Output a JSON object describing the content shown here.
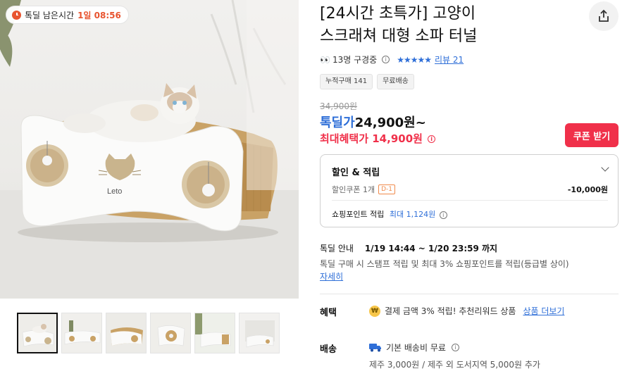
{
  "timer": {
    "label": "톡딜 남은시간",
    "value": "1일 08:56"
  },
  "product": {
    "title_line1": "[24시간 초특가] 고양이",
    "title_line2": "스크래쳐 대형 소파 터널",
    "viewers": "13명 구경중",
    "stars": "★★★★★",
    "rating": 5,
    "review_link": "리뷰 21",
    "chips": [
      "누적구매 141",
      "무료배송"
    ],
    "original_price": "34,900원",
    "deal_label": "톡딜가",
    "deal_price": "24,900원~",
    "max_benefit_label": "최대혜택가",
    "max_benefit_price": "14,900원",
    "coupon_button": "쿠폰 받기"
  },
  "discount": {
    "title": "할인 & 적립",
    "coupon_label": "할인쿠폰 1개",
    "coupon_badge": "D-1",
    "coupon_value": "-10,000원",
    "point_label": "쇼핑포인트 적립",
    "point_value": "최대 1,124원"
  },
  "deal_info": {
    "label": "톡딜 안내",
    "period": "1/19 14:44 ~ 1/20 23:59 까지",
    "description": "톡딜 구매 시 스탬프 적립 및 최대 3% 쇼핑포인트를 적립(등급별 상이)",
    "more_link": "자세히"
  },
  "benefit": {
    "label": "혜택",
    "coin_icon_text": "₩",
    "text": "결제 금액 3% 적립! 추천리워드 상품",
    "more_link": "상품 더보기"
  },
  "shipping": {
    "label": "배송",
    "text": "기본 배송비 무료",
    "extra": "제주 3,000원 / 제주 외 도서지역 5,000원 추가"
  },
  "gallery": {
    "brand_mark": "Leto",
    "thumbnails": [
      "thumb-1",
      "thumb-2",
      "thumb-3",
      "thumb-4",
      "thumb-5",
      "thumb-6"
    ],
    "active_index": 0
  },
  "colors": {
    "accent_blue": "#2f6fd8",
    "accent_red": "#f0304a",
    "timer_orange": "#e8542f"
  }
}
